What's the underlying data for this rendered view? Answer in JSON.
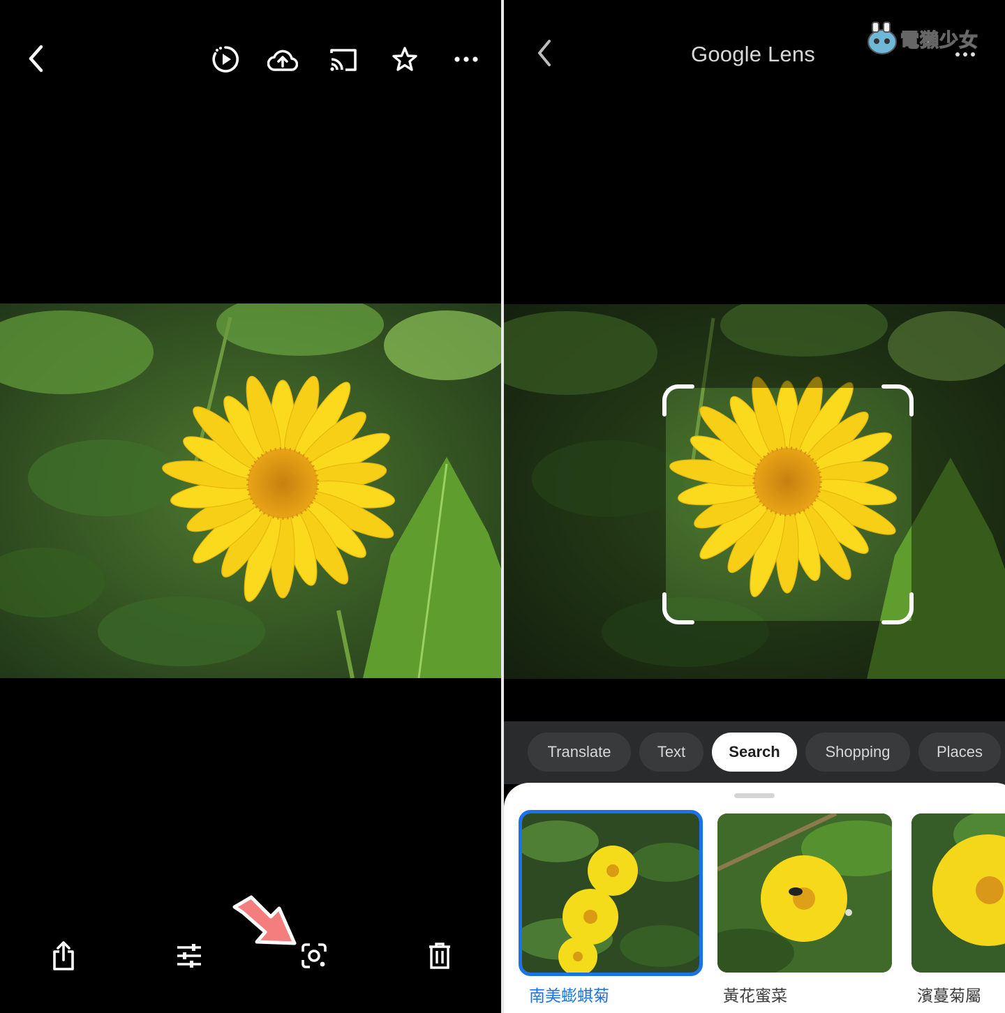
{
  "photos_viewer": {
    "top_bar": {
      "icons": [
        "back-arrow-icon",
        "motion-play-icon",
        "cloud-upload-icon",
        "cast-icon",
        "star-icon",
        "more-horizontal-icon"
      ]
    },
    "bottom_bar": {
      "icons": [
        "share-icon",
        "edit-sliders-icon",
        "lens-icon",
        "trash-icon"
      ]
    },
    "annotation_arrow_color": "#f47d7d"
  },
  "lens": {
    "title": "Google Lens",
    "watermark": "電獺少女",
    "modes": [
      "Translate",
      "Text",
      "Search",
      "Shopping",
      "Places"
    ],
    "active_mode": "Search",
    "results": [
      {
        "label": "南美蟛蜞菊"
      },
      {
        "label": "黃花蜜菜"
      },
      {
        "label": "濱蔓菊屬"
      }
    ],
    "accent_color": "#1a73e8"
  }
}
